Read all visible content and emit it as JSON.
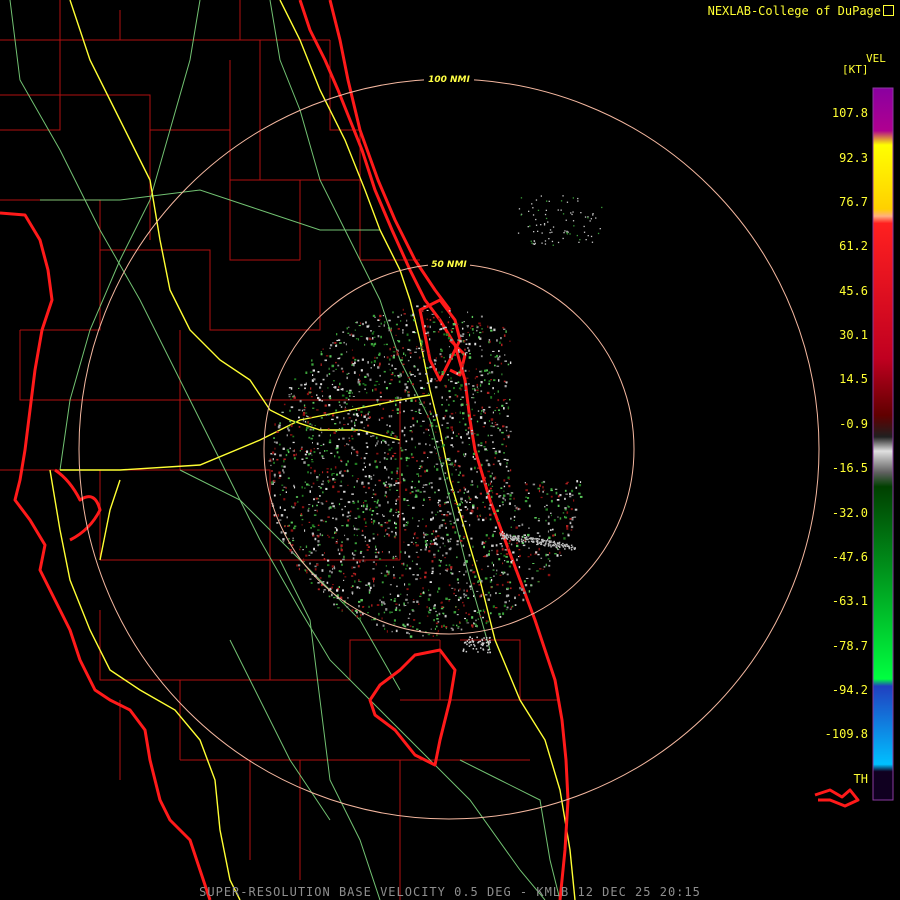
{
  "credit": "NEXLAB-College of DuPage",
  "legend": {
    "product": "VEL",
    "unit": "[KT]",
    "ticks": [
      "107.8",
      "92.3",
      "76.7",
      "61.2",
      "45.6",
      "30.1",
      "14.5",
      "-0.9",
      "-16.5",
      "-32.0",
      "-47.6",
      "-63.1",
      "-78.7",
      "-94.2",
      "-109.8"
    ],
    "th_label": "TH"
  },
  "range_rings": {
    "outer": "100 NMI",
    "inner": "50 NMI"
  },
  "footer": "SUPER-RESOLUTION BASE VELOCITY 0.5 DEG - KMLB 12 DEC 25 20:15",
  "colors": {
    "coast": "#ff1a1a",
    "county": "#b01010",
    "highway_major": "#ffff33",
    "highway_minor": "#7fd77f",
    "ring": "#f5b8a0",
    "text": "#ffff33"
  }
}
